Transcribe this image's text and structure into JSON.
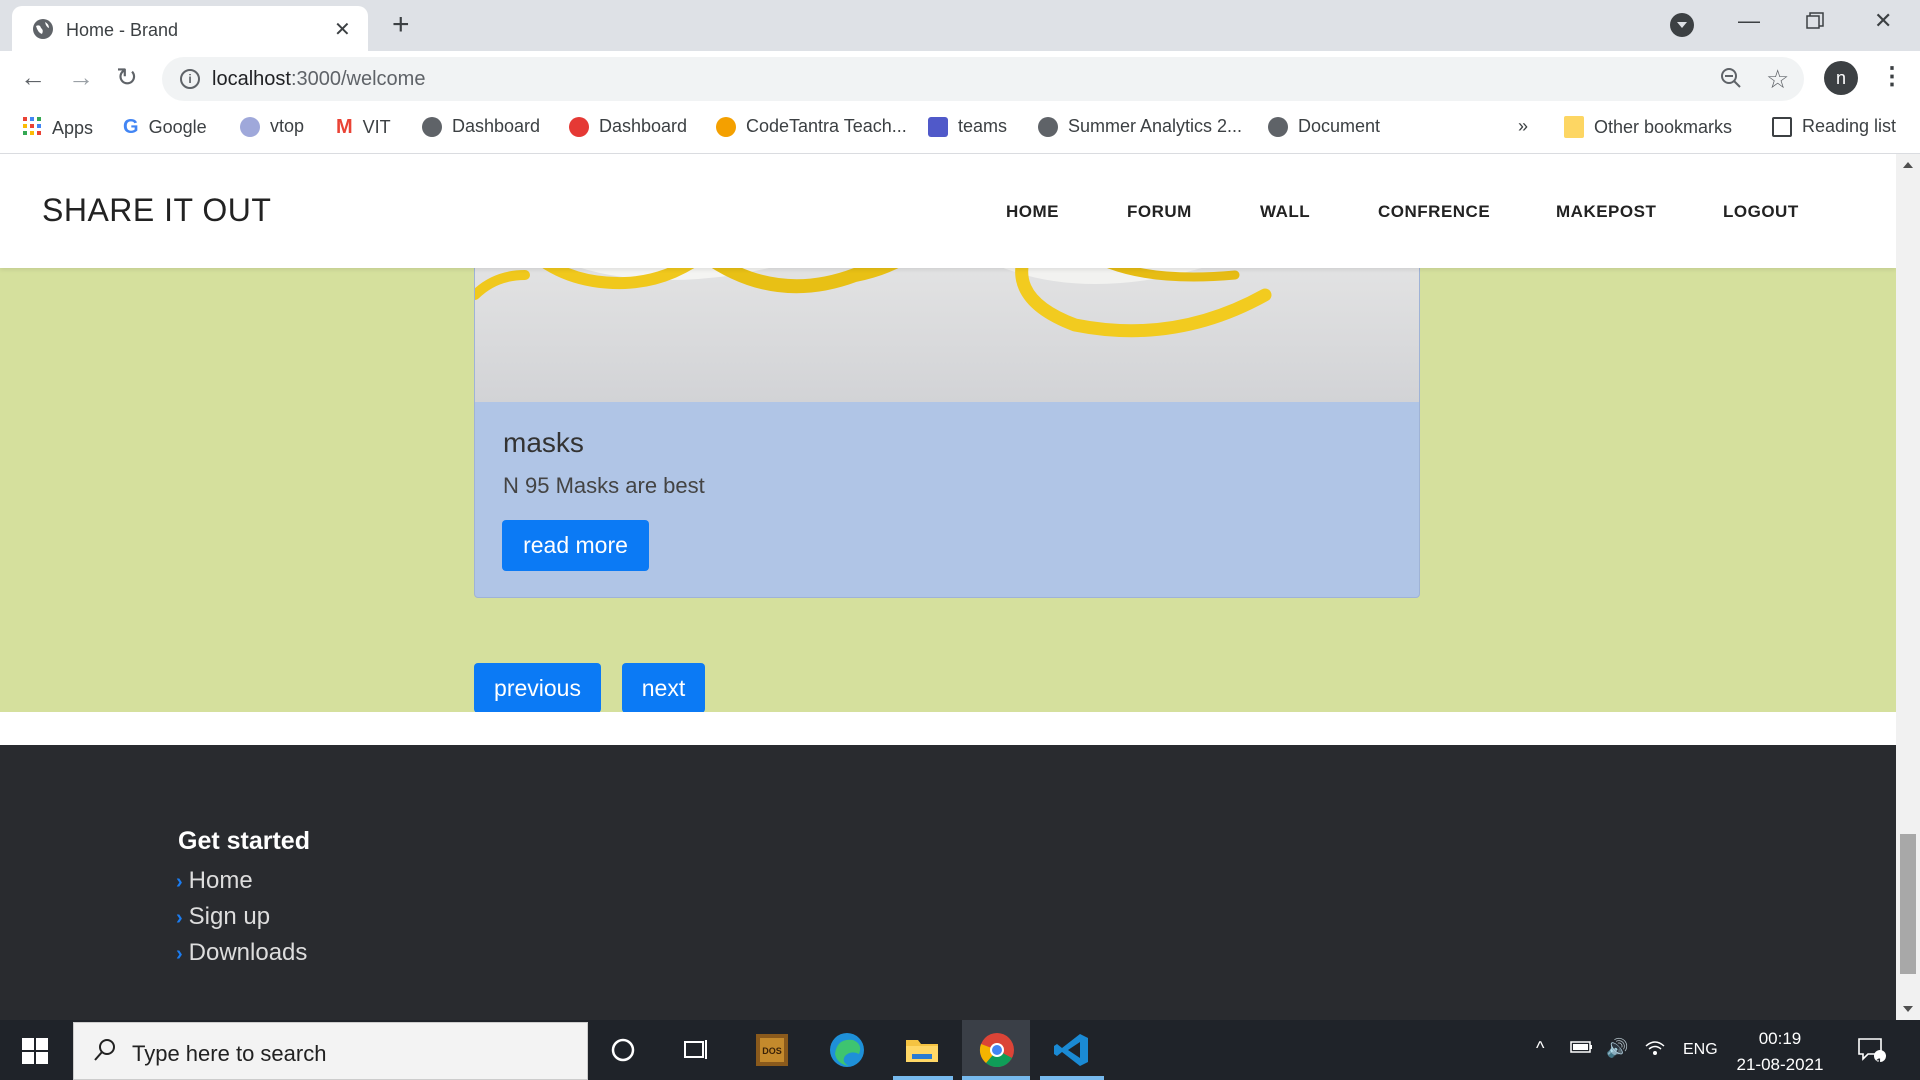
{
  "browser": {
    "tab_title": "Home - Brand",
    "url_host": "localhost",
    "url_rest": ":3000/welcome",
    "profile_initial": "n"
  },
  "bookmarks": {
    "items": [
      {
        "label": "Apps",
        "icon": "apps-grid-icon"
      },
      {
        "label": "Google",
        "icon": "google-icon"
      },
      {
        "label": "vtop",
        "icon": "vtop-icon"
      },
      {
        "label": "VIT",
        "icon": "gmail-icon"
      },
      {
        "label": "Dashboard",
        "icon": "globe-icon"
      },
      {
        "label": "Dashboard",
        "icon": "dashboard-icon"
      },
      {
        "label": "CodeTantra Teach...",
        "icon": "codetantra-icon"
      },
      {
        "label": "teams",
        "icon": "teams-icon"
      },
      {
        "label": "Summer Analytics 2...",
        "icon": "globe-icon"
      },
      {
        "label": "Document",
        "icon": "globe-icon"
      }
    ],
    "overflow": "»",
    "other": "Other bookmarks",
    "reading_list": "Reading list"
  },
  "site": {
    "brand": "SHARE IT OUT",
    "nav": [
      "HOME",
      "FORUM",
      "WALL",
      "CONFRENCE",
      "MAKEPOST",
      "LOGOUT"
    ],
    "card": {
      "title": "masks",
      "text": "N 95 Masks are best",
      "button": "read more"
    },
    "pagination": {
      "previous": "previous",
      "next": "next"
    },
    "footer": {
      "heading": "Get started",
      "links": [
        "Home",
        "Sign up",
        "Downloads"
      ]
    }
  },
  "taskbar": {
    "search_placeholder": "Type here to search",
    "language": "ENG",
    "time": "00:19",
    "date": "21-08-2021",
    "notification_count": "1"
  },
  "colors": {
    "page_bg": "#d5e09d",
    "card_bg": "#b0c5e6",
    "button": "#0b7af5",
    "footer_bg": "#292b2f"
  }
}
